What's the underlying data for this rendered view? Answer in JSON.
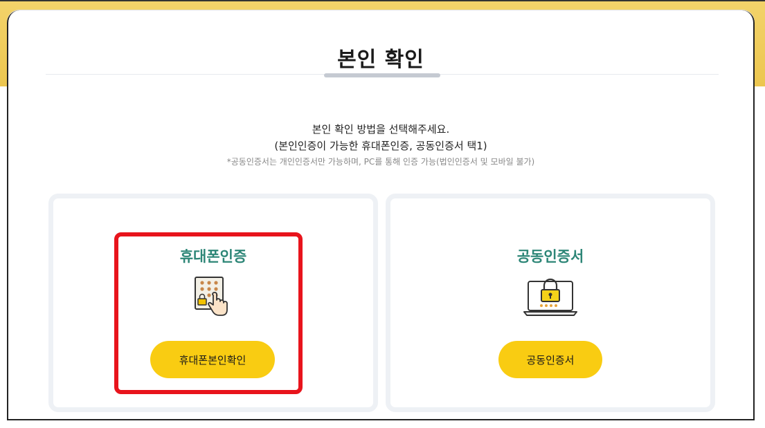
{
  "modal": {
    "title": "본인 확인"
  },
  "guide": {
    "line1": "본인 확인 방법을 선택해주세요.",
    "line2": "(본인인증이 가능한 휴대폰인증, 공동인증서 택1)",
    "note": "*공동인증서는 개인인증서만 가능하며, PC를 통해 인증 가능(법인인증서 및 모바일 불가)"
  },
  "options": [
    {
      "title": "휴대폰인증",
      "icon": "phone-keypad-icon",
      "button_label": "휴대폰본인확인"
    },
    {
      "title": "공동인증서",
      "icon": "laptop-lock-icon",
      "button_label": "공동인증서"
    }
  ],
  "colors": {
    "accent": "#f9cc12",
    "title_green": "#2d8677",
    "highlight": "#e8141c",
    "card_border": "#eef1f5"
  }
}
